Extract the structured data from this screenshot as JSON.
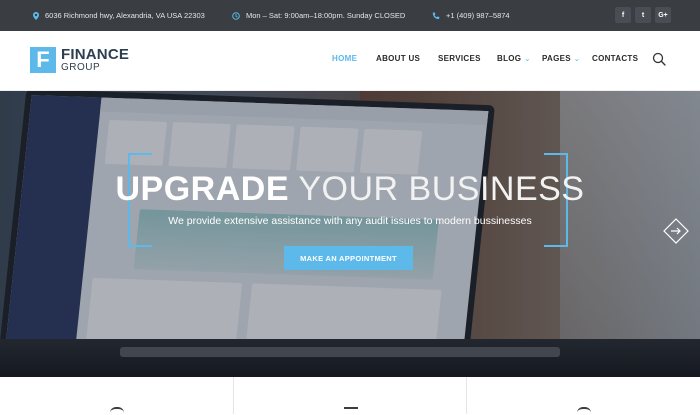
{
  "topbar": {
    "address": "6036 Richmond hwy, Alexandria, VA USA 22303",
    "hours": "Mon – Sat: 9:00am–18:00pm. Sunday CLOSED",
    "phone": "+1 (409) 987–5874",
    "social": [
      "f",
      "t",
      "G+"
    ]
  },
  "header": {
    "logo_letter": "F",
    "logo_title": "FINANCE",
    "logo_subtitle": "GROUP",
    "nav": [
      {
        "label": "HOME",
        "active": true
      },
      {
        "label": "ABOUT US"
      },
      {
        "label": "SERVICES"
      },
      {
        "label": "BLOG"
      },
      {
        "label": "PAGES"
      },
      {
        "label": "CONTACTS"
      }
    ]
  },
  "hero": {
    "headline_bold": "UPGRADE",
    "headline_light": " YOUR BUSINESS",
    "subline": "We provide extensive assistance with any audit issues to modern bussinesses",
    "cta_label": "MAKE AN APPOINTMENT"
  },
  "colors": {
    "accent": "#5cb9ea",
    "topbar_bg": "#3a3d42",
    "nav_text": "#2a2a2a"
  },
  "icons": [
    "location-pin-icon",
    "clock-icon",
    "phone-icon",
    "facebook-icon",
    "twitter-icon",
    "google-plus-icon",
    "search-icon",
    "chevron-down-icon",
    "arrow-right-icon"
  ]
}
